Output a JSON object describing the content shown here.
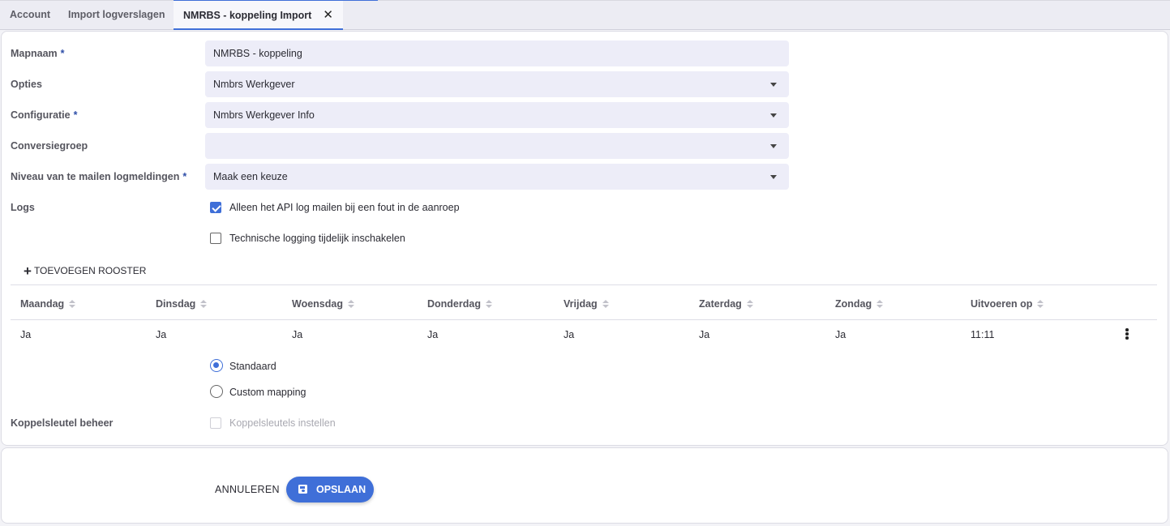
{
  "tabs": [
    {
      "label": "Account",
      "active": false
    },
    {
      "label": "Import logverslagen",
      "active": false
    },
    {
      "label": "NMRBS - koppeling Import",
      "active": true,
      "close_icon": "close-icon"
    }
  ],
  "form": {
    "mapnaam": {
      "label": "Mapnaam",
      "required": "*",
      "value": "NMRBS - koppeling"
    },
    "opties": {
      "label": "Opties",
      "value": "Nmbrs Werkgever"
    },
    "configuratie": {
      "label": "Configuratie",
      "required": "*",
      "value": "Nmbrs Werkgever Info"
    },
    "conversiegroep": {
      "label": "Conversiegroep",
      "value": ""
    },
    "niveau": {
      "label": "Niveau van te mailen logmeldingen",
      "required": "*",
      "value": "Maak een keuze"
    },
    "logs": {
      "label": "Logs",
      "options": [
        {
          "label": "Alleen het API log mailen bij een fout in de aanroep",
          "checked": true
        },
        {
          "label": "Technische logging tijdelijk inschakelen",
          "checked": false
        }
      ]
    }
  },
  "schedule": {
    "add_label": "TOEVOEGEN ROOSTER",
    "columns": [
      "Maandag",
      "Dinsdag",
      "Woensdag",
      "Donderdag",
      "Vrijdag",
      "Zaterdag",
      "Zondag",
      "Uitvoeren op"
    ],
    "rows": [
      [
        "Ja",
        "Ja",
        "Ja",
        "Ja",
        "Ja",
        "Ja",
        "Ja",
        "11:11"
      ]
    ]
  },
  "mapping": {
    "options": [
      {
        "label": "Standaard",
        "selected": true
      },
      {
        "label": "Custom mapping",
        "selected": false
      }
    ]
  },
  "koppelsleutel": {
    "label": "Koppelsleutel beheer",
    "checkbox_label": "Koppelsleutels instellen",
    "checked": false,
    "disabled": true
  },
  "actions": {
    "cancel_label": "ANNULEREN",
    "save_label": "OPSLAAN"
  },
  "colors": {
    "accent": "#3f6fd8",
    "field_bg": "#ededf8",
    "page_bg": "#f3f3f7"
  }
}
